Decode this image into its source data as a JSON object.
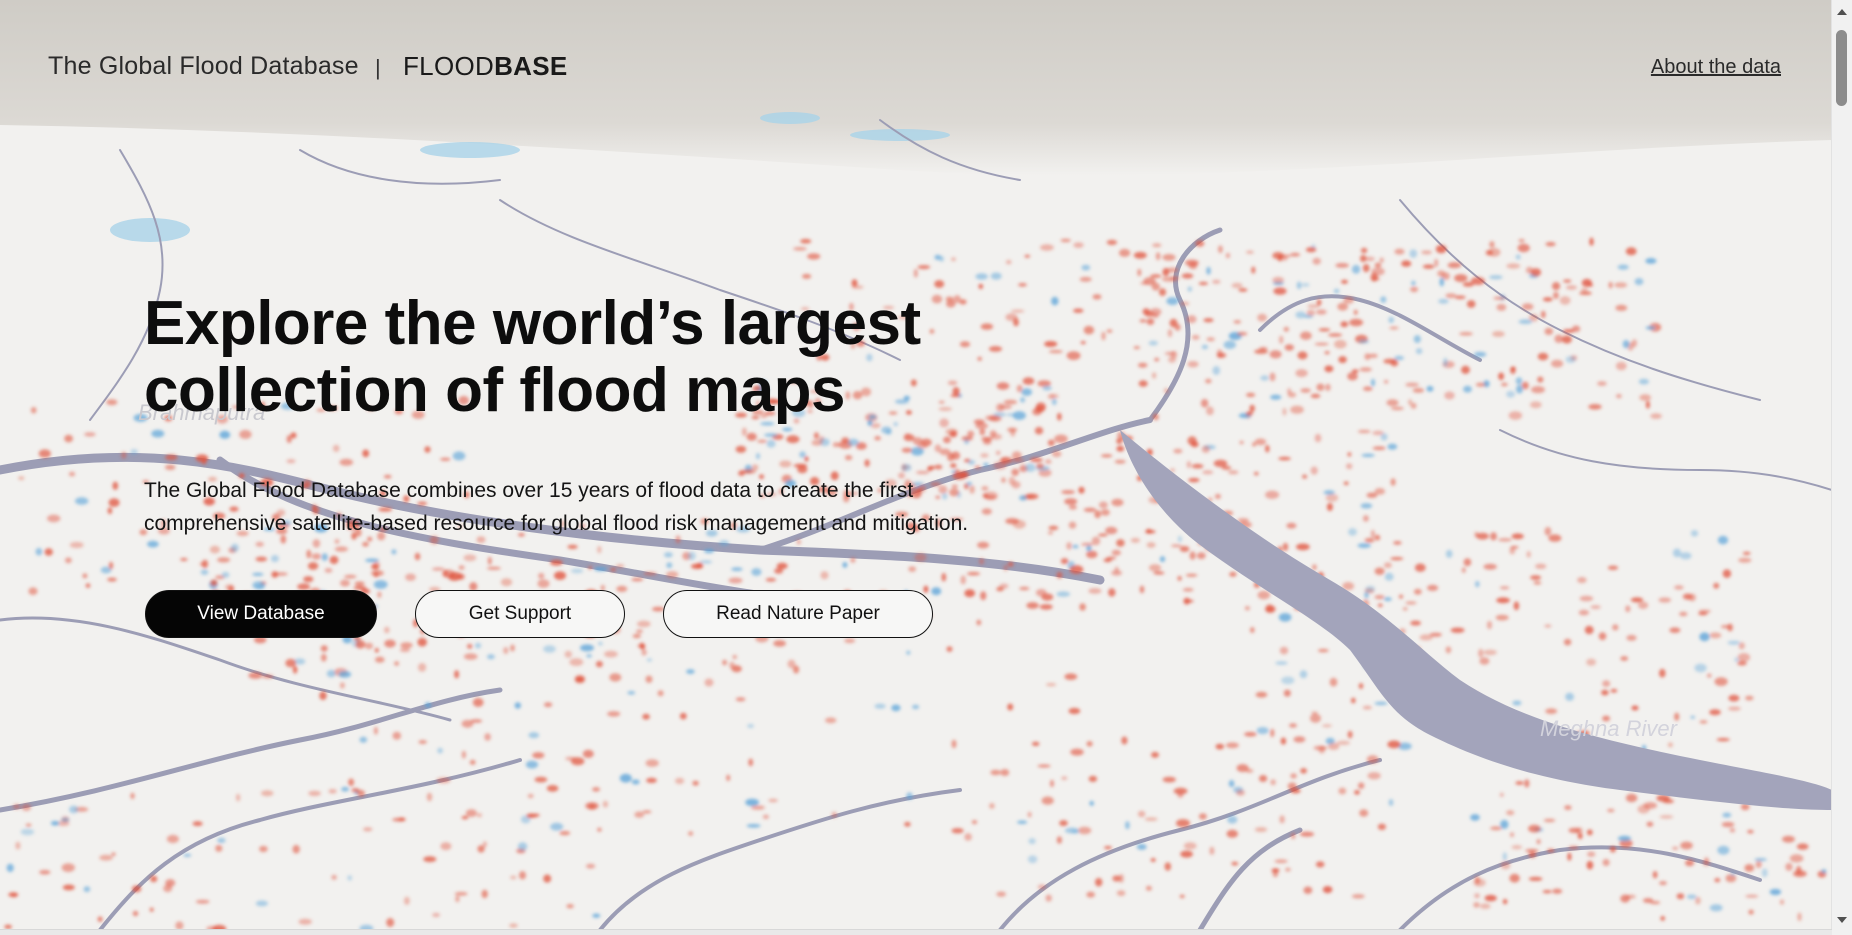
{
  "header": {
    "site_title": "The Global Flood Database",
    "separator": "|",
    "brand_light": "FLOOD",
    "brand_bold": "BASE",
    "about_link": "About the data"
  },
  "hero": {
    "title_line1": "Explore the world’s largest",
    "title_line2": "collection of flood maps",
    "description_line1": "The Global Flood Database combines over 15 years of flood data to create the first",
    "description_line2": "comprehensive satellite-based resource for global flood risk management and mitigation."
  },
  "buttons": {
    "view_database": "View Database",
    "get_support": "Get Support",
    "read_paper": "Read Nature Paper"
  },
  "map": {
    "labels": {
      "river_left": "Brahmaputra",
      "river_right": "Meghna River"
    },
    "colors": {
      "land": "#f2f1ef",
      "water": "#9c9db5",
      "flood_red": "#e0533d",
      "flood_blue": "#5aa3d8",
      "terrain": "#d5d2cc"
    }
  }
}
